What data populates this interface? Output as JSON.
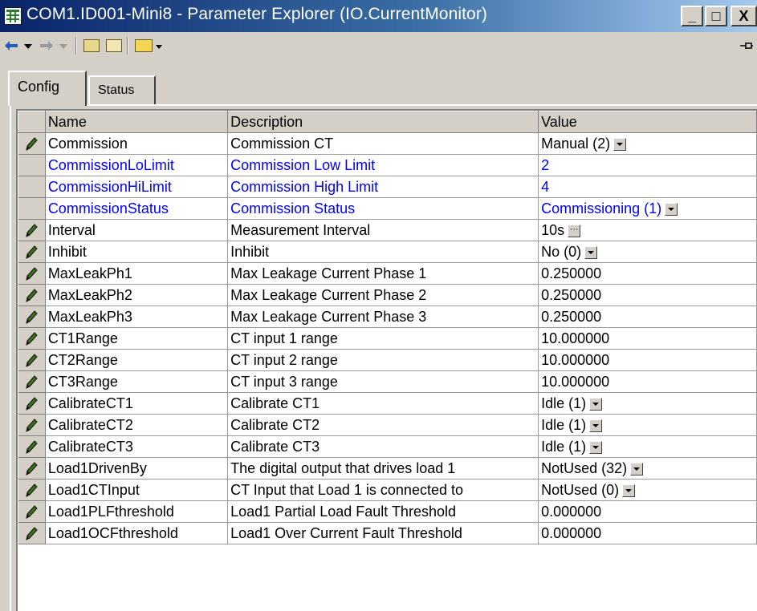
{
  "window": {
    "title": "COM1.ID001-Mini8 - Parameter Explorer (IO.CurrentMonitor)",
    "buttons": {
      "minimize": "_",
      "maximize": "□",
      "close": "X"
    }
  },
  "toolbar": {
    "icons": [
      "back-arrow-icon",
      "dropdown-arrow-icon",
      "forward-arrow-icon",
      "dropdown-arrow-icon",
      "folder-up-icon",
      "folder-icon",
      "open-folder-icon",
      "dropdown-arrow-icon",
      "pin-icon"
    ]
  },
  "tabs": [
    {
      "label": "Config",
      "active": true
    },
    {
      "label": "Status",
      "active": false
    }
  ],
  "table": {
    "columns": {
      "name": "Name",
      "description": "Description",
      "value": "Value"
    },
    "rows": [
      {
        "name": "Commission",
        "description": "Commission CT",
        "value": "Manual (2)",
        "editable": true,
        "control": "dropdown",
        "color": "black"
      },
      {
        "name": "CommissionLoLimit",
        "description": "Commission Low Limit",
        "value": "2",
        "editable": false,
        "control": "",
        "color": "blue"
      },
      {
        "name": "CommissionHiLimit",
        "description": "Commission High Limit",
        "value": "4",
        "editable": false,
        "control": "",
        "color": "blue"
      },
      {
        "name": "CommissionStatus",
        "description": "Commission Status",
        "value": "Commissioning (1)",
        "editable": false,
        "control": "dropdown",
        "color": "blue"
      },
      {
        "name": "Interval",
        "description": "Measurement Interval",
        "value": "10s",
        "editable": true,
        "control": "ellipsis",
        "color": "black"
      },
      {
        "name": "Inhibit",
        "description": "Inhibit",
        "value": "No (0)",
        "editable": true,
        "control": "dropdown",
        "color": "black"
      },
      {
        "name": "MaxLeakPh1",
        "description": "Max Leakage Current Phase 1",
        "value": "0.250000",
        "editable": true,
        "control": "",
        "color": "black"
      },
      {
        "name": "MaxLeakPh2",
        "description": "Max Leakage Current Phase 2",
        "value": "0.250000",
        "editable": true,
        "control": "",
        "color": "black"
      },
      {
        "name": "MaxLeakPh3",
        "description": "Max Leakage Current Phase 3",
        "value": "0.250000",
        "editable": true,
        "control": "",
        "color": "black"
      },
      {
        "name": "CT1Range",
        "description": "CT input 1 range",
        "value": "10.000000",
        "editable": true,
        "control": "",
        "color": "black"
      },
      {
        "name": "CT2Range",
        "description": "CT input 2 range",
        "value": "10.000000",
        "editable": true,
        "control": "",
        "color": "black"
      },
      {
        "name": "CT3Range",
        "description": "CT input 3 range",
        "value": "10.000000",
        "editable": true,
        "control": "",
        "color": "black"
      },
      {
        "name": "CalibrateCT1",
        "description": "Calibrate CT1",
        "value": "Idle (1)",
        "editable": true,
        "control": "dropdown",
        "color": "black"
      },
      {
        "name": "CalibrateCT2",
        "description": "Calibrate CT2",
        "value": "Idle (1)",
        "editable": true,
        "control": "dropdown",
        "color": "black"
      },
      {
        "name": "CalibrateCT3",
        "description": "Calibrate CT3",
        "value": "Idle (1)",
        "editable": true,
        "control": "dropdown",
        "color": "black"
      },
      {
        "name": "Load1DrivenBy",
        "description": "The digital output that drives load 1",
        "value": "NotUsed (32)",
        "editable": true,
        "control": "dropdown",
        "color": "black"
      },
      {
        "name": "Load1CTInput",
        "description": "CT Input that Load 1 is connected to",
        "value": "NotUsed (0)",
        "editable": true,
        "control": "dropdown",
        "color": "black"
      },
      {
        "name": "Load1PLFthreshold",
        "description": "Load1 Partial Load Fault Threshold",
        "value": "0.000000",
        "editable": true,
        "control": "",
        "color": "black"
      },
      {
        "name": "Load1OCFthreshold",
        "description": "Load1 Over Current Fault Threshold",
        "value": "0.000000",
        "editable": true,
        "control": "",
        "color": "black"
      }
    ]
  },
  "colors": {
    "title_gradient_start": "#0a246a",
    "title_gradient_end": "#a6caf0",
    "readonly_text": "#0000ff",
    "pencil": "#3c6e1e"
  }
}
